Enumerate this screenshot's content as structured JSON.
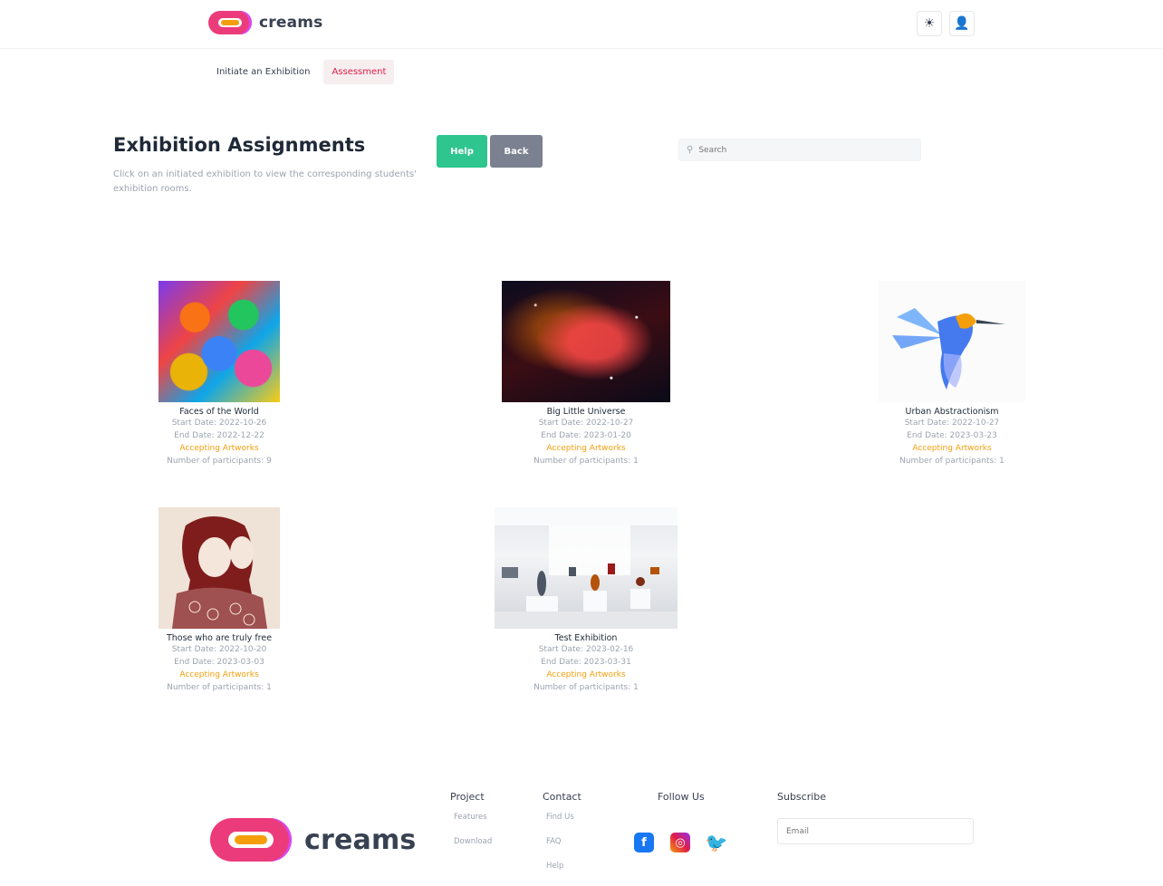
{
  "header": {
    "brand": "creams",
    "theme_icon": "sun-icon",
    "user_icon": "user-icon"
  },
  "nav": {
    "items": [
      {
        "label": "Initiate an Exhibition",
        "active": false
      },
      {
        "label": "Assessment",
        "active": true
      }
    ]
  },
  "main": {
    "title": "Exhibition Assignments",
    "description": "Click on an initiated exhibition to view the corresponding students' exhibition rooms.",
    "help_label": "Help",
    "back_label": "Back",
    "search_placeholder": "Search"
  },
  "exhibitions": [
    {
      "name": "Faces of the World",
      "start": "Start Date: 2022-10-26",
      "end": "End Date: 2022-12-22",
      "status": "Accepting Artworks",
      "participants": "Number of participants: 9"
    },
    {
      "name": "Big Little Universe",
      "start": "Start Date: 2022-10-27",
      "end": "End Date: 2023-01-20",
      "status": "Accepting Artworks",
      "participants": "Number of participants: 1"
    },
    {
      "name": "Urban Abstractionism",
      "start": "Start Date: 2022-10-27",
      "end": "End Date: 2023-03-23",
      "status": "Accepting Artworks",
      "participants": "Number of participants: 1"
    },
    {
      "name": "Those who are truly free",
      "start": "Start Date: 2022-10-20",
      "end": "End Date: 2023-03-03",
      "status": "Accepting Artworks",
      "participants": "Number of participants: 1"
    },
    {
      "name": "Test Exhibition",
      "start": "Start Date: 2023-02-16",
      "end": "End Date: 2023-03-31",
      "status": "Accepting Artworks",
      "participants": "Number of participants: 1"
    }
  ],
  "footer": {
    "brand": "creams",
    "project": {
      "title": "Project",
      "links": [
        "Features",
        "Download"
      ]
    },
    "contact": {
      "title": "Contact",
      "links": [
        "Find Us",
        "FAQ",
        "Help"
      ]
    },
    "follow": {
      "title": "Follow Us"
    },
    "subscribe": {
      "title": "Subscribe",
      "placeholder": "Email"
    }
  },
  "colors": {
    "accent": "#e11d48",
    "help": "#2ec58e",
    "back": "#7b8190",
    "status": "#f59e0b"
  }
}
